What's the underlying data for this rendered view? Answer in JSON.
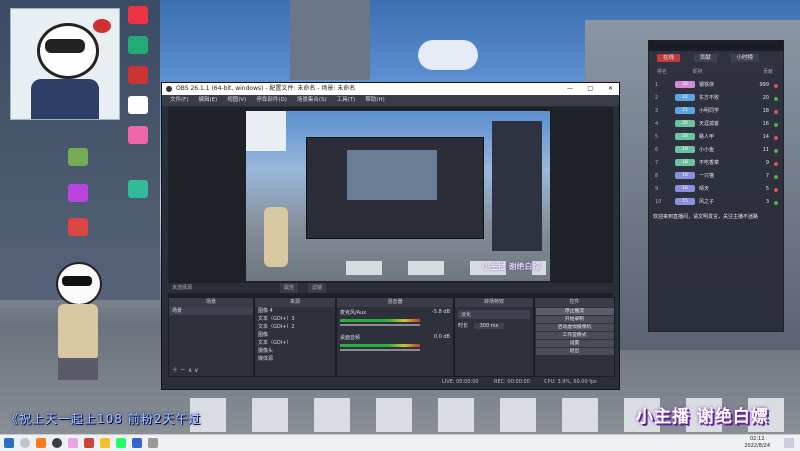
{
  "obs": {
    "title": "OBS 26.1.1 (64-bit, windows) - 配置文件: 未命名 - 场景: 未命名",
    "menu": [
      "文件(F)",
      "编辑(E)",
      "视图(V)",
      "停靠部件(D)",
      "场景集合(S)",
      "工具(T)",
      "帮助(H)"
    ],
    "window_controls": [
      "—",
      "□",
      "✕"
    ],
    "source_label": "未选择源",
    "props_buttons": [
      "属性",
      "滤镜"
    ],
    "docks": {
      "scenes": {
        "title": "场景",
        "items": [
          "场景"
        ]
      },
      "sources": {
        "title": "来源",
        "items": [
          "图像 4",
          "文本（GDI+）3",
          "文本（GDI+）2",
          "图像",
          "文本（GDI+）",
          "摄像头",
          "媒体源",
          "显示器"
        ]
      },
      "mixer": {
        "title": "混音器",
        "tracks": [
          {
            "name": "麦克风/Aux",
            "db": "-5.8 dB"
          },
          {
            "name": "桌面音频",
            "db": "0.0 dB"
          }
        ]
      },
      "transitions": {
        "title": "转场特效",
        "type": "淡化",
        "duration_label": "时长",
        "duration": "300 ms"
      },
      "controls": {
        "title": "控件",
        "buttons": [
          "停止推流",
          "开始录制",
          "启动虚拟摄像机",
          "工作室模式",
          "设置",
          "退出"
        ]
      }
    },
    "status": {
      "live": "LIVE: 00:00:00",
      "rec": "REC: 00:00:00",
      "cpu": "CPU: 3.9%, 60.00 fps"
    },
    "scene_overlay_text": "小主播 谢绝白嫖"
  },
  "chat": {
    "tabs": [
      "在线",
      "贡献",
      "小时榜"
    ],
    "columns": [
      "排名",
      "昵称",
      "贡献"
    ],
    "rows": [
      {
        "rank": "1",
        "level": "30",
        "name": "钢铁侠",
        "score": "999",
        "color": "#d28ad8"
      },
      {
        "rank": "2",
        "level": "22",
        "name": "东方不败",
        "score": "20",
        "color": "#5aa7e2"
      },
      {
        "rank": "3",
        "level": "21",
        "name": "小明同学",
        "score": "18",
        "color": "#5aa7e2"
      },
      {
        "rank": "4",
        "level": "20",
        "name": "天涯孤客",
        "score": "16",
        "color": "#6cc3a0"
      },
      {
        "rank": "5",
        "level": "20",
        "name": "路人甲",
        "score": "14",
        "color": "#6cc3a0"
      },
      {
        "rank": "6",
        "level": "19",
        "name": "小小鱼",
        "score": "11",
        "color": "#6cc3a0"
      },
      {
        "rank": "7",
        "level": "18",
        "name": "不吃香菜",
        "score": "9",
        "color": "#6cc3a0"
      },
      {
        "rank": "8",
        "level": "18",
        "name": "一只猫",
        "score": "7",
        "color": "#8a8fe0"
      },
      {
        "rank": "9",
        "level": "16",
        "name": "晴天",
        "score": "5",
        "color": "#8a8fe0"
      },
      {
        "rank": "10",
        "level": "15",
        "name": "风之子",
        "score": "3",
        "color": "#8a8fe0"
      }
    ],
    "notice": "欢迎来到直播间，请文明发言，关注主播不迷路"
  },
  "overlay": {
    "ticker": "《祝上天一起上108 前粉2天午过",
    "streamer_tag": "小主播 谢绝白嫖"
  },
  "taskbar": {
    "time": "02:12",
    "date": "2022/8/24"
  },
  "colors": {
    "accent": "#a9c6ff",
    "obs_bg": "#2b2e38",
    "stop_btn": "#4a4d58"
  }
}
